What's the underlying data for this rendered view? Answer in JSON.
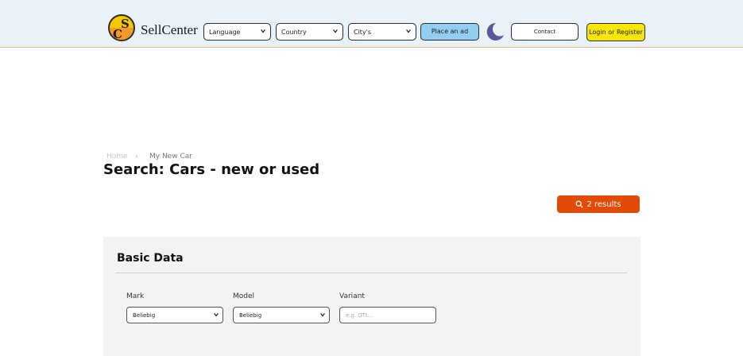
{
  "header": {
    "brand": "SellCenter",
    "logo_letters": [
      "S",
      "C"
    ],
    "language": "Language",
    "country": "Country",
    "city": "City's",
    "place_ad": "Place an ad",
    "contact": "Contact",
    "login": "Login or Register",
    "theme_icon": "moon-icon",
    "colors": {
      "header_bg": "#e8f2f8",
      "place_ad": "#92cdf2",
      "login": "#f8e800"
    }
  },
  "breadcrumb": {
    "home": "Home",
    "current": "My New Car"
  },
  "page": {
    "title": "Search: Cars - new or used"
  },
  "results": {
    "label": "2 results",
    "icon": "search-icon",
    "color": "#e24a08"
  },
  "basic_data": {
    "title": "Basic Data",
    "mark": {
      "label": "Mark",
      "value": "Beliebig"
    },
    "model": {
      "label": "Model",
      "value": "Beliebig"
    },
    "variant": {
      "label": "Variant",
      "placeholder": "e.g. GTI..."
    }
  }
}
